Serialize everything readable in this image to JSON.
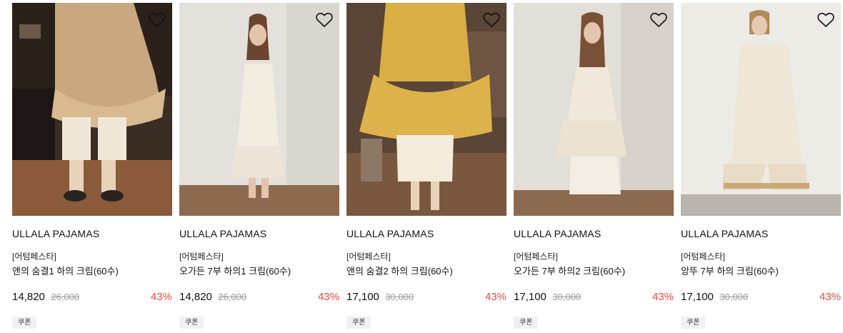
{
  "products": [
    {
      "brand": "ULLALA PAJAMAS",
      "promo": "[어텀페스타]",
      "name": "앤의 숨결1 하의 크림(60수)",
      "price": "14,820",
      "original_price": "26,000",
      "discount": "43%",
      "badge": "쿠폰",
      "wishlist_icon": "heart-outline-icon"
    },
    {
      "brand": "ULLALA PAJAMAS",
      "promo": "[어텀페스타]",
      "name": "오가든 7부 하의1 크림(60수)",
      "price": "14,820",
      "original_price": "26,000",
      "discount": "43%",
      "badge": "쿠폰",
      "wishlist_icon": "heart-outline-icon"
    },
    {
      "brand": "ULLALA PAJAMAS",
      "promo": "[어텀페스타]",
      "name": "앤의 숨결2 하의 크림(60수)",
      "price": "17,100",
      "original_price": "30,000",
      "discount": "43%",
      "badge": "쿠폰",
      "wishlist_icon": "heart-outline-icon"
    },
    {
      "brand": "ULLALA PAJAMAS",
      "promo": "[어텀페스타]",
      "name": "오가든 7부 하의2 크림(60수)",
      "price": "17,100",
      "original_price": "30,000",
      "discount": "43%",
      "badge": "쿠폰",
      "wishlist_icon": "heart-outline-icon"
    },
    {
      "brand": "ULLALA PAJAMAS",
      "promo": "[어텀페스타]",
      "name": "앙뚜 7부 하의 크림(60수)",
      "price": "17,100",
      "original_price": "30,000",
      "discount": "43%",
      "badge": "쿠폰",
      "wishlist_icon": "heart-outline-icon"
    }
  ],
  "colors": {
    "discount": "#ef4a3c",
    "strike_price": "#9a9a9a",
    "coupon_bg": "#f1f1f1"
  }
}
